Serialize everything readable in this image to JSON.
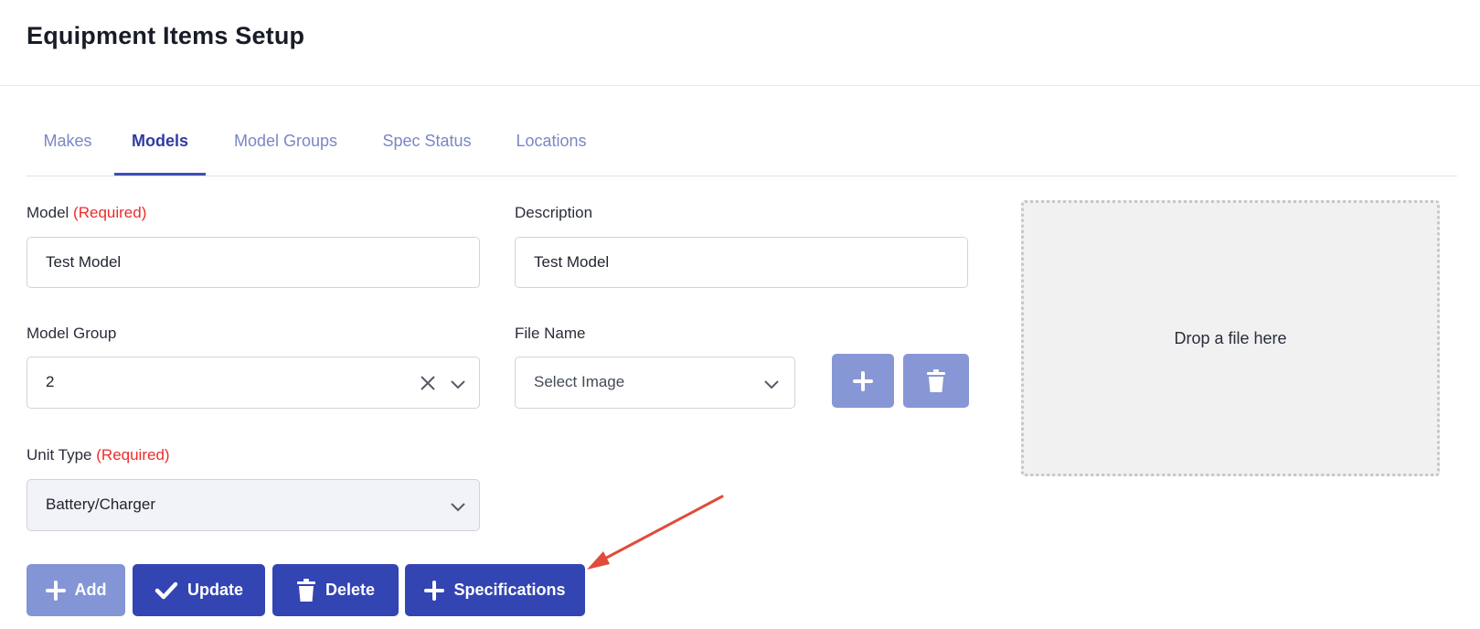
{
  "page": {
    "title": "Equipment Items Setup"
  },
  "tabs": [
    {
      "label": "Makes",
      "active": false
    },
    {
      "label": "Models",
      "active": true
    },
    {
      "label": "Model Groups",
      "active": false
    },
    {
      "label": "Spec Status",
      "active": false
    },
    {
      "label": "Locations",
      "active": false
    }
  ],
  "form": {
    "model": {
      "label": "Model",
      "required": "(Required)",
      "value": "Test Model"
    },
    "description": {
      "label": "Description",
      "value": "Test Model"
    },
    "model_group": {
      "label": "Model Group",
      "value": "2"
    },
    "file_name": {
      "label": "File Name",
      "placeholder": "Select Image"
    },
    "unit_type": {
      "label": "Unit Type",
      "required": "(Required)",
      "value": "Battery/Charger"
    }
  },
  "dropzone": {
    "text": "Drop a file here"
  },
  "actions": {
    "add": "Add",
    "update": "Update",
    "delete": "Delete",
    "specifications": "Specifications"
  },
  "icons": {
    "add_image": "plus-icon",
    "delete_image": "trash-icon",
    "annotation": "red-arrow"
  },
  "colors": {
    "primary": "#3344b3",
    "primary_disabled": "#8495d6",
    "tab_inactive": "#7b86c5",
    "tab_active": "#2f3ca3",
    "required": "#ee2b2b",
    "annotation_arrow": "#e14b3b"
  }
}
